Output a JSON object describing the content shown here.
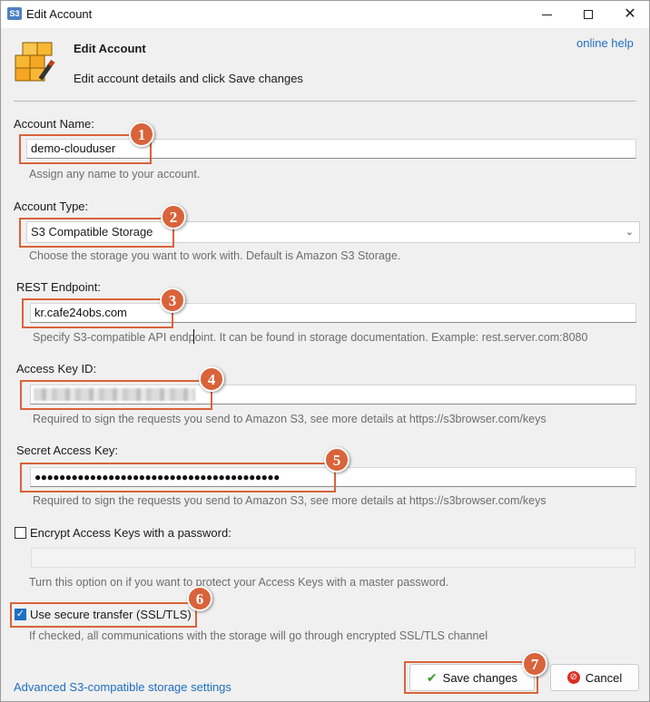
{
  "window": {
    "title": "Edit Account",
    "app_icon_text": "S3"
  },
  "header": {
    "title": "Edit Account",
    "subtitle": "Edit account details and click Save changes",
    "help_link": "online help"
  },
  "fields": {
    "account_name": {
      "label": "Account Name:",
      "value": "demo-clouduser",
      "hint": "Assign any name to your account."
    },
    "account_type": {
      "label": "Account Type:",
      "value": "S3 Compatible Storage",
      "hint": "Choose the storage you want to work with. Default is Amazon S3 Storage."
    },
    "rest_endpoint": {
      "label": "REST Endpoint:",
      "value": "kr.cafe24obs.com",
      "hint": "Specify S3-compatible API endpoint. It can be found in storage documentation. Example: rest.server.com:8080"
    },
    "access_key_id": {
      "label": "Access Key ID:",
      "hint": "Required to sign the requests you send to Amazon S3, see more details at https://s3browser.com/keys"
    },
    "secret_access_key": {
      "label": "Secret Access Key:",
      "value": "●●●●●●●●●●●●●●●●●●●●●●●●●●●●●●●●●●●●●●●●",
      "hint": "Required to sign the requests you send to Amazon S3, see more details at https://s3browser.com/keys"
    },
    "encrypt_keys": {
      "label": "Encrypt Access Keys with a password:",
      "checked": false,
      "hint": "Turn this option on if you want to protect your Access Keys with a master password."
    },
    "secure_transfer": {
      "label": "Use secure transfer (SSL/TLS)",
      "checked": true,
      "hint": "If checked, all communications with the storage will go through encrypted SSL/TLS channel"
    }
  },
  "footer": {
    "advanced_link": "Advanced S3-compatible storage settings",
    "save_label": "Save changes",
    "cancel_label": "Cancel"
  },
  "callouts": [
    "1",
    "2",
    "3",
    "4",
    "5",
    "6",
    "7"
  ],
  "colors": {
    "callout": "#d9633a",
    "link": "#1f6fc5",
    "check": "#1f6fc5"
  }
}
